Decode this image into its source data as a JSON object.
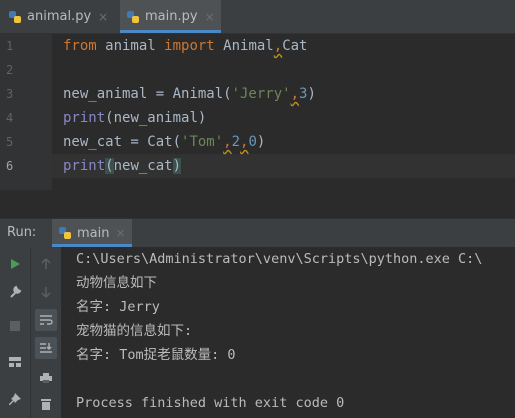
{
  "tabs": [
    {
      "label": "animal.py",
      "active": false
    },
    {
      "label": "main.py",
      "active": true
    }
  ],
  "line_numbers": [
    "1",
    "2",
    "3",
    "4",
    "5",
    "6"
  ],
  "code": {
    "line1": {
      "kw1": "from",
      "mod": " animal ",
      "kw2": "import",
      "names": " Animal",
      "comma": ",",
      "cat": "Cat"
    },
    "line3": {
      "lhs": "new_animal = Animal(",
      "str": "'Jerry'",
      "comma": ",",
      "num": "3",
      "close": ")"
    },
    "line4": {
      "fn": "print",
      "rest": "(new_animal)"
    },
    "line5": {
      "lhs": "new_cat = Cat(",
      "str": "'Tom'",
      "c1": ",",
      "n1": "2",
      "c2": ",",
      "n2": "0",
      "close": ")"
    },
    "line6": {
      "fn": "print",
      "open": "(",
      "arg": "new_cat",
      "close": ")"
    }
  },
  "run": {
    "label": "Run:",
    "tab": "main"
  },
  "console": [
    "C:\\Users\\Administrator\\venv\\Scripts\\python.exe C:\\",
    "动物信息如下",
    "名字: Jerry",
    "宠物猫的信息如下:",
    "名字: Tom捉老鼠数量: 0",
    "",
    "Process finished with exit code 0"
  ],
  "close_glyph": "×",
  "colors": {
    "keyword": "#cc7832",
    "string": "#6a8759",
    "number": "#6897bb",
    "builtin": "#8888c6",
    "accent": "#4a88c7"
  }
}
